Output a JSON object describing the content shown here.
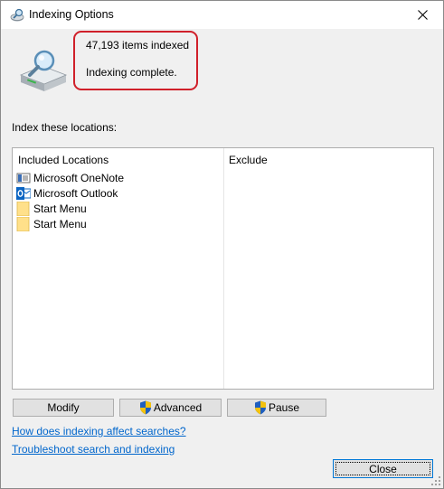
{
  "window": {
    "title": "Indexing Options",
    "title_icon": "indexing-options-icon",
    "close_icon": "close-icon"
  },
  "status": {
    "items_indexed": "47,193 items indexed",
    "state": "Indexing complete.",
    "highlight_color": "#d0202a"
  },
  "locations": {
    "label": "Index these locations:",
    "headers": {
      "included": "Included Locations",
      "exclude": "Exclude"
    },
    "rows": [
      {
        "name": "Microsoft OneNote",
        "icon": "onenote-icon"
      },
      {
        "name": "Microsoft Outlook",
        "icon": "outlook-icon"
      },
      {
        "name": "Start Menu",
        "icon": "folder-icon"
      },
      {
        "name": "Start Menu",
        "icon": "folder-icon"
      }
    ]
  },
  "buttons": {
    "modify": "Modify",
    "advanced": "Advanced",
    "pause": "Pause",
    "close": "Close"
  },
  "links": {
    "affect": "How does indexing affect searches?",
    "troubleshoot": "Troubleshoot search and indexing"
  },
  "colors": {
    "link": "#0066cc",
    "focus_border": "#0078d7",
    "shield_blue": "#1f5fbf",
    "shield_yellow": "#f4c20d"
  }
}
